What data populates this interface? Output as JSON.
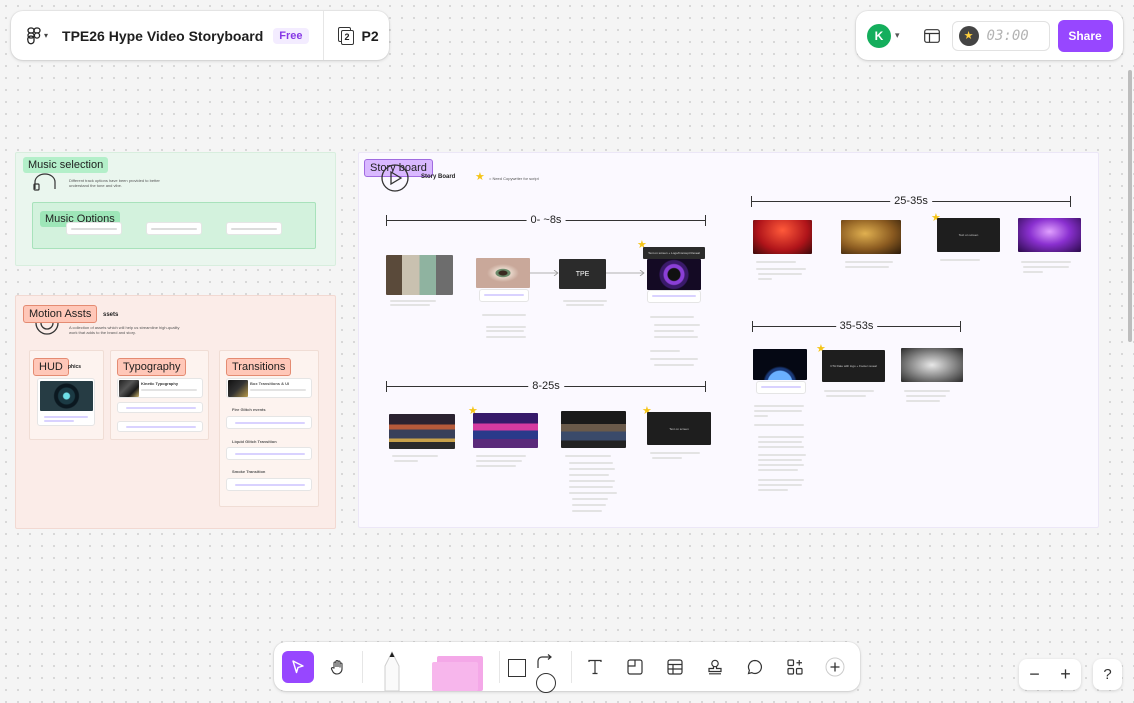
{
  "file": {
    "title": "TPE26 Hype Video Storyboard",
    "plan": "Free",
    "page": "P2",
    "page_icon_num": "2"
  },
  "user": {
    "initial": "K",
    "avatar_color": "#14ae5c"
  },
  "timer": {
    "value": "03:00"
  },
  "share_label": "Share",
  "accent": "#9747ff",
  "sections": {
    "music_selection": {
      "label": "Music selection",
      "desc": "Different track options have been provided to better understand the tone and vibe.",
      "options_label": "Music Options"
    },
    "motion_assets": {
      "label": "Motion Assts",
      "title_fragment": "ssets",
      "desc": "A collection of assets which will help us streamline high-quality work that adds to the brand and story.",
      "hud": {
        "label": "HUD",
        "fragment": "phics"
      },
      "typography": {
        "label": "Typography",
        "card_title": "Kinetic Typography"
      },
      "transitions": {
        "label": "Transitions",
        "card_title": "Box Transitions & UI",
        "sub1": "Fire Glitch events",
        "sub2": "Liquid Glitch Transition",
        "sub3": "Smoke Transition"
      }
    },
    "storyboard": {
      "label": "Story board",
      "title": "Story Board",
      "legend": "= Need Copywriter for script",
      "segments": [
        "0- ~8s",
        "8-25s",
        "25-35s",
        "35-53s"
      ],
      "logo_text": "TPE",
      "callout_1": "Text on screen + Logo/Concept Reveal",
      "callout_2": "Text on screen",
      "callout_3": "Text on screen",
      "callout_4": "CTA Date with logo + Footer reveal"
    }
  },
  "toolbar": {
    "tools": [
      "move-tool",
      "hand-tool",
      "pencil-tool",
      "sticky-note-tool",
      "shape-tool",
      "connector-tool",
      "text-tool",
      "section-tool",
      "table-tool",
      "stamp-tool",
      "comment-tool",
      "more-tools",
      "add-tool"
    ]
  },
  "zoom": {
    "minus": "−",
    "plus": "+"
  },
  "help": "?"
}
